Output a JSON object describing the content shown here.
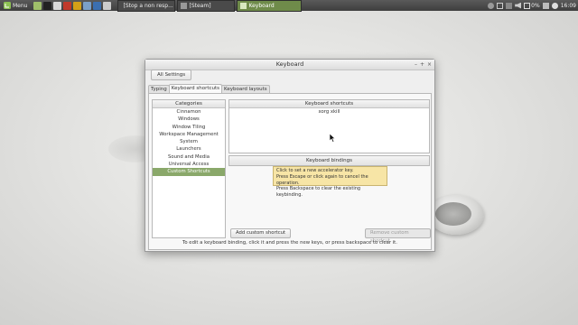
{
  "panel": {
    "menu_label": "Menu",
    "launchers": [
      {
        "icon": "show-desktop-icon",
        "color": "#9fbf6a"
      },
      {
        "icon": "terminal-icon",
        "color": "#222222"
      },
      {
        "icon": "file-manager-icon",
        "color": "#d9d9d9"
      },
      {
        "icon": "app-icon",
        "color": "#c0392b"
      },
      {
        "icon": "app-icon",
        "color": "#d4a017"
      },
      {
        "icon": "folder-icon",
        "color": "#7ba0c8"
      },
      {
        "icon": "app-icon",
        "color": "#3b6fb0"
      },
      {
        "icon": "app-icon",
        "color": "#cccccc"
      }
    ],
    "tasks": [
      {
        "label": "[Stop a non resp...",
        "active": false
      },
      {
        "label": "[Steam]",
        "active": false
      },
      {
        "label": "Keyboard",
        "active": true
      }
    ],
    "tray": {
      "battery_percent": "0%",
      "time": "16:09"
    }
  },
  "window": {
    "title": "Keyboard",
    "controls": {
      "minimize": "–",
      "maximize": "+",
      "close": "×"
    },
    "all_settings_label": "All Settings",
    "tabs": [
      {
        "label": "Typing",
        "selected": false
      },
      {
        "label": "Keyboard shortcuts",
        "selected": true
      },
      {
        "label": "Keyboard layouts",
        "selected": false
      }
    ],
    "categories_header": "Categories",
    "categories": [
      {
        "label": "Cinnamon",
        "selected": false
      },
      {
        "label": "Windows",
        "selected": false
      },
      {
        "label": "Window Tiling",
        "selected": false
      },
      {
        "label": "Workspace Management",
        "selected": false
      },
      {
        "label": "System",
        "selected": false
      },
      {
        "label": "Launchers",
        "selected": false
      },
      {
        "label": "Sound and Media",
        "selected": false
      },
      {
        "label": "Universal Access",
        "selected": false
      },
      {
        "label": "Custom Shortcuts",
        "selected": true
      }
    ],
    "shortcuts_header": "Keyboard shortcuts",
    "shortcuts": [
      "xorg xkill"
    ],
    "bindings_header": "Keyboard bindings",
    "tooltip": {
      "line1": "Click to set a new accelerator key.",
      "line2": "Press Escape or click again to cancel the operation.",
      "line3": "Press Backspace to clear the existing keybinding."
    },
    "add_custom_label": "Add custom shortcut",
    "remove_custom_label": "Remove custom shortcut",
    "footer_note": "To edit a keyboard binding, click it and press the new keys, or press backspace to clear it."
  }
}
